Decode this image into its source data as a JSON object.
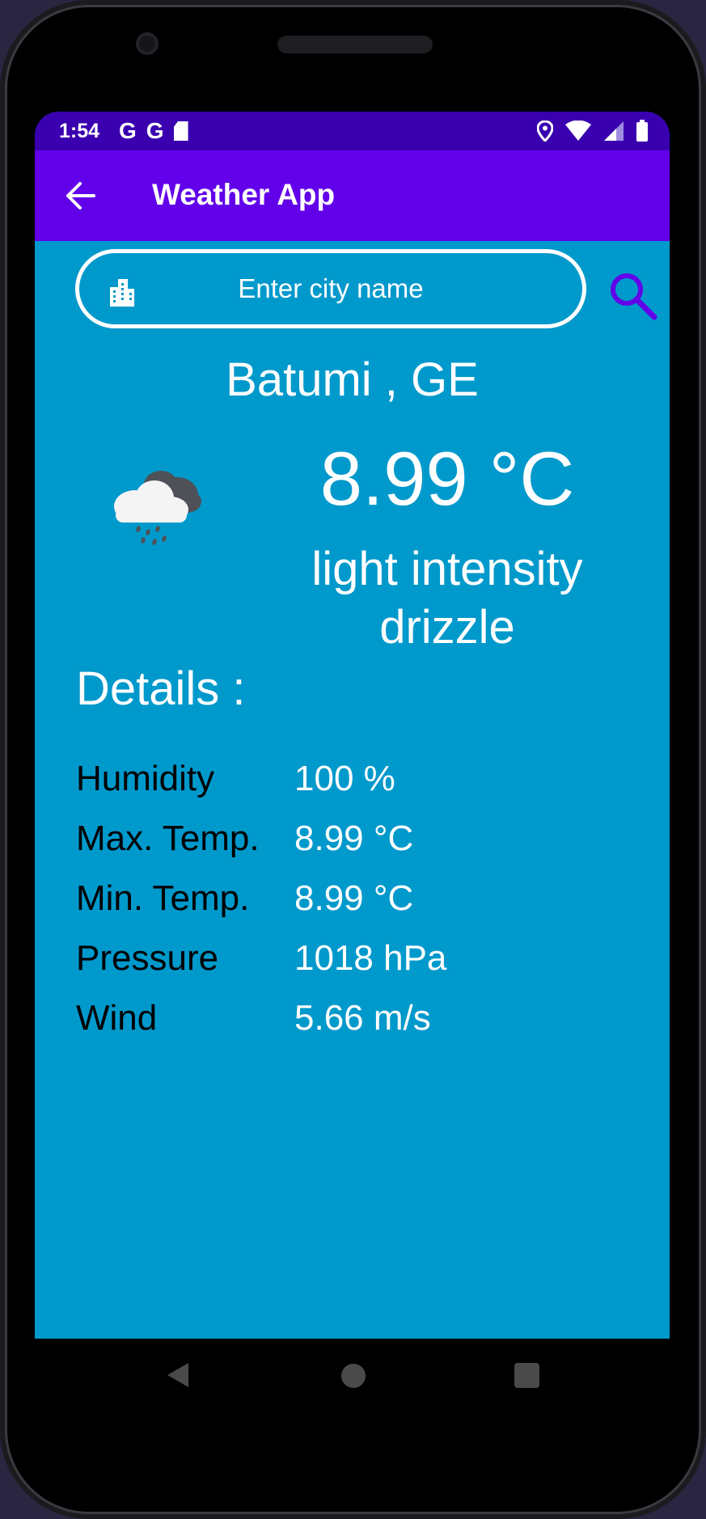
{
  "statusbar": {
    "time": "1:54",
    "icons_left": [
      "google-g-icon",
      "google-g-icon",
      "sd-card-icon"
    ],
    "icons_right": [
      "location-pin-icon",
      "wifi-icon",
      "signal-icon",
      "battery-icon"
    ]
  },
  "appbar": {
    "title": "Weather App",
    "back_icon": "arrow-back-icon"
  },
  "search": {
    "placeholder": "Enter city name",
    "icon_left": "city-icon",
    "button_icon": "search-icon"
  },
  "weather": {
    "location": "Batumi , GE",
    "temperature": "8.99 °C",
    "condition_line1": "light intensity",
    "condition_line2": "drizzle",
    "icon": "rain-cloud-icon"
  },
  "details": {
    "title": "Details :",
    "rows": [
      {
        "label": "Humidity",
        "value": "100 %"
      },
      {
        "label": "Max. Temp.",
        "value": "8.99 °C"
      },
      {
        "label": "Min. Temp.",
        "value": "8.99 °C"
      },
      {
        "label": "Pressure",
        "value": "1018 hPa"
      },
      {
        "label": "Wind",
        "value": "5.66 m/s"
      }
    ]
  },
  "colors": {
    "status_bar": "#3a00b0",
    "app_bar": "#6200ea",
    "background": "#0099cc",
    "search_icon": "#6200ea"
  },
  "navbar": {
    "buttons": [
      "nav-back-icon",
      "nav-home-icon",
      "nav-recents-icon"
    ]
  }
}
